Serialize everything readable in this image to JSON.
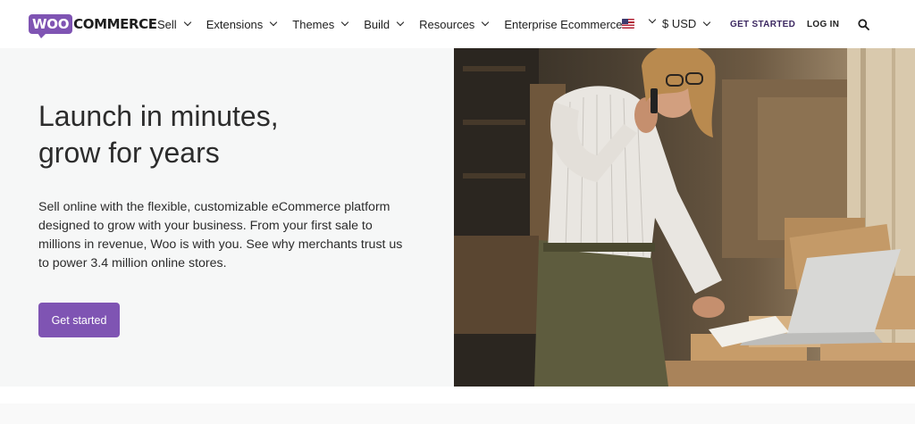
{
  "brand": {
    "logo_mark": "WOO",
    "logo_word": "COMMERCE",
    "accent": "#7f54b3",
    "dark_purple": "#3c2861"
  },
  "nav": {
    "items": [
      {
        "label": "Sell",
        "has_dropdown": true
      },
      {
        "label": "Extensions",
        "has_dropdown": true
      },
      {
        "label": "Themes",
        "has_dropdown": true
      },
      {
        "label": "Build",
        "has_dropdown": true
      },
      {
        "label": "Resources",
        "has_dropdown": true
      },
      {
        "label": "Enterprise Ecommerce",
        "has_dropdown": false
      }
    ],
    "locale_icon": "us-flag-icon",
    "currency": "$ USD",
    "get_started": "GET STARTED",
    "login": "LOG IN",
    "search_icon": "search-icon"
  },
  "hero": {
    "title_line1": "Launch in minutes,",
    "title_line2": "grow for years",
    "description": "Sell online with the flexible, customizable eCommerce platform designed to grow with your business. From your first sale to millions in revenue, Woo is with you. See why merchants trust us to power 3.4 million online stores.",
    "cta_label": "Get started",
    "background": "#f6f7f7"
  }
}
